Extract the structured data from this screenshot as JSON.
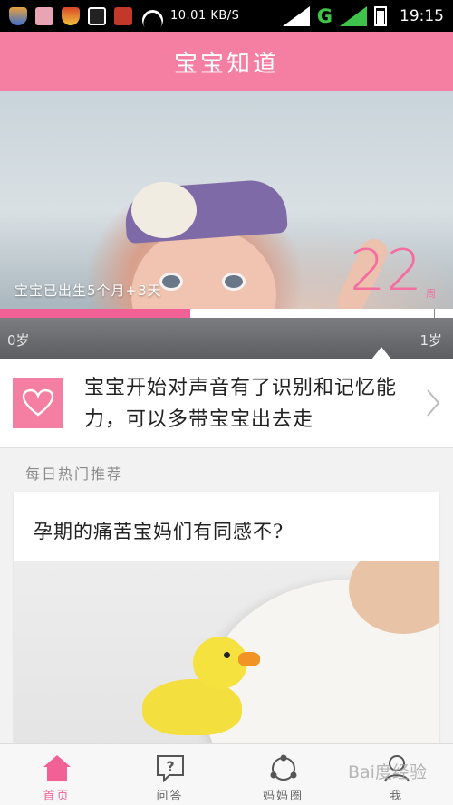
{
  "status_bar": {
    "network_speed": "10.01 KB/S",
    "network_type": "G",
    "time": "19:15",
    "icons": [
      "shield-icon",
      "cat-app-icon",
      "shield-app-icon",
      "image-icon",
      "chest-app-icon",
      "wifi-icon",
      "signal-icon",
      "battery-icon"
    ]
  },
  "header": {
    "title": "宝宝知道"
  },
  "banner": {
    "age_text": "宝宝已出生5个月+3天",
    "week_number": "22",
    "week_unit": "周"
  },
  "progress": {
    "fraction": 0.42,
    "start_label": "0岁",
    "end_label": "1岁"
  },
  "tip": {
    "text": "宝宝开始对声音有了识别和记忆能力，可以多带宝宝出去走",
    "icon": "heart-icon"
  },
  "section": {
    "title": "每日热门推荐"
  },
  "article": {
    "title": "孕期的痛苦宝妈们有同感不?"
  },
  "tabs": [
    {
      "label": "首页",
      "icon": "home-icon",
      "active": true
    },
    {
      "label": "问答",
      "icon": "question-icon",
      "active": false
    },
    {
      "label": "妈妈圈",
      "icon": "circle-icon",
      "active": false
    },
    {
      "label": "我",
      "icon": "profile-icon",
      "active": false
    }
  ],
  "watermark": {
    "text": "Bai度经验"
  },
  "colors": {
    "brand_pink": "#f57fa3",
    "progress_pink": "#f16196"
  }
}
